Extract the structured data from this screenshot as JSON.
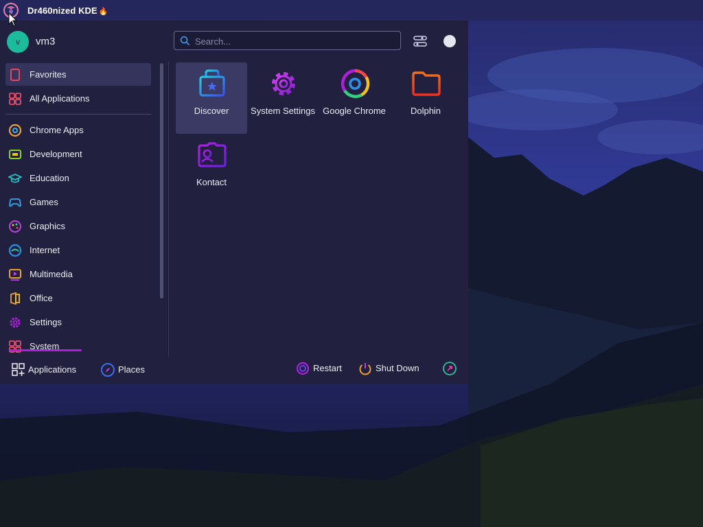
{
  "panel": {
    "title": "Dr460nized KDE",
    "flame_icon": "fire-emoji"
  },
  "user": {
    "avatar_letter": "v",
    "name": "vm3"
  },
  "search": {
    "placeholder": "Search..."
  },
  "sidebar": {
    "items": [
      {
        "label": "Favorites",
        "icon": "bookmark-icon",
        "selected": true
      },
      {
        "label": "All Applications",
        "icon": "grid-icon"
      },
      {
        "label": "Chrome Apps",
        "icon": "chrome-icon"
      },
      {
        "label": "Development",
        "icon": "development-icon"
      },
      {
        "label": "Education",
        "icon": "education-icon"
      },
      {
        "label": "Games",
        "icon": "gamepad-icon"
      },
      {
        "label": "Graphics",
        "icon": "graphics-icon"
      },
      {
        "label": "Internet",
        "icon": "internet-icon"
      },
      {
        "label": "Multimedia",
        "icon": "multimedia-icon"
      },
      {
        "label": "Office",
        "icon": "office-icon"
      },
      {
        "label": "Settings",
        "icon": "settings-icon"
      },
      {
        "label": "System",
        "icon": "system-icon"
      }
    ]
  },
  "apps": [
    {
      "label": "Discover",
      "icon": "discover-icon",
      "selected": true
    },
    {
      "label": "System Settings",
      "icon": "system-settings-icon"
    },
    {
      "label": "Google Chrome",
      "icon": "chrome-icon"
    },
    {
      "label": "Dolphin",
      "icon": "folder-icon"
    },
    {
      "label": "Kontact",
      "icon": "contact-card-icon"
    }
  ],
  "bottom": {
    "applications": "Applications",
    "places": "Places",
    "restart": "Restart",
    "shutdown": "Shut Down"
  },
  "colors": {
    "accent_magenta": "#b21de0",
    "avatar_teal": "#1abc9c",
    "launcher_bg": "#21213f"
  }
}
